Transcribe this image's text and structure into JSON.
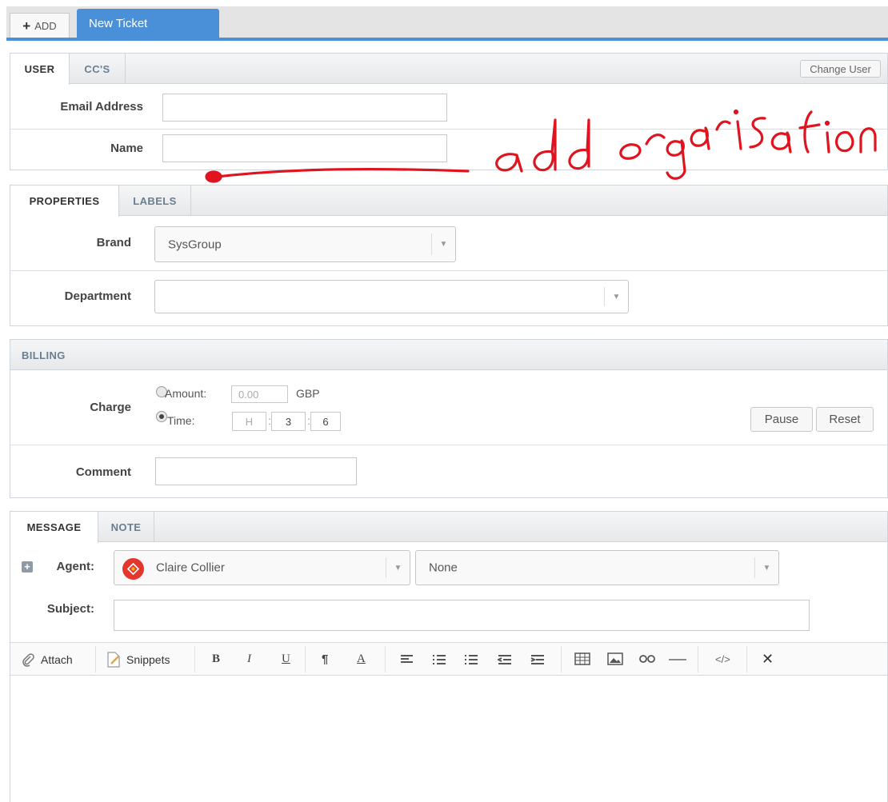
{
  "tabs": {
    "add_label": "ADD",
    "new_ticket": "New Ticket"
  },
  "user_panel": {
    "tabs": [
      "USER",
      "CC'S"
    ],
    "change_user": "Change User",
    "email_label": "Email Address",
    "email_value": "",
    "name_label": "Name",
    "name_value": ""
  },
  "annotation": {
    "text": "add organisation",
    "color": "#e0141e"
  },
  "properties_panel": {
    "tabs": [
      "PROPERTIES",
      "LABELS"
    ],
    "brand_label": "Brand",
    "brand_value": "SysGroup",
    "department_label": "Department",
    "department_value": ""
  },
  "billing_panel": {
    "title": "BILLING",
    "charge_label": "Charge",
    "amount_label": "Amount:",
    "amount_placeholder": "0.00",
    "currency": "GBP",
    "time_label": "Time:",
    "hours_placeholder": "H",
    "minutes": "3",
    "seconds": "6",
    "selected_option": "Time",
    "pause": "Pause",
    "reset": "Reset",
    "comment_label": "Comment",
    "comment_value": ""
  },
  "message_panel": {
    "tabs": [
      "MESSAGE",
      "NOTE"
    ],
    "agent_label": "Agent:",
    "agent_value": "Claire Collier",
    "second_select_value": "None",
    "subject_label": "Subject:",
    "subject_value": "",
    "toolbar": {
      "attach": "Attach",
      "snippets": "Snippets",
      "bold": "B",
      "italic": "I",
      "underline": "U",
      "paragraph": "¶",
      "font_color": "A",
      "code": "</>",
      "close": "✕"
    }
  }
}
